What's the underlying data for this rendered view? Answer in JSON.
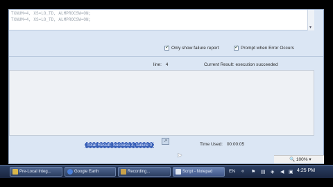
{
  "log": {
    "lines": [
      "TXNUM=4, XS=LO_TD, ALMPROCSW=ON;",
      "TXNUM=4, XS=LO_TD, ALMPROCSW=ON;"
    ],
    "scroll_arrow": "▾"
  },
  "options": {
    "only_show_failure": {
      "label": "Only show failure report",
      "checked": true
    },
    "prompt_on_error": {
      "label": "Prompt when Error Occurs",
      "checked": true
    }
  },
  "status": {
    "line_label": "line:",
    "line_value": "4",
    "current_result": "Current Result: execution succeeded"
  },
  "bottom": {
    "total_result": "Total Result: Success 3, failure 0",
    "time_used_label": "Time Used:",
    "time_used_value": "00:00:05"
  },
  "statusbar": {
    "zoom": "100%"
  },
  "taskbar": {
    "items": [
      {
        "label": "Pre-Local Integ...",
        "icon_color": "#d9b64a",
        "active": false
      },
      {
        "label": "Google Earth",
        "icon_color": "#4a7fd9",
        "active": false
      },
      {
        "label": "Recording...",
        "icon_color": "#c9a24a",
        "active": false
      },
      {
        "label": "Script - Notepad",
        "icon_color": "#dfe6f0",
        "active": true
      }
    ],
    "language": "EN",
    "clock": "4:25 PM"
  }
}
